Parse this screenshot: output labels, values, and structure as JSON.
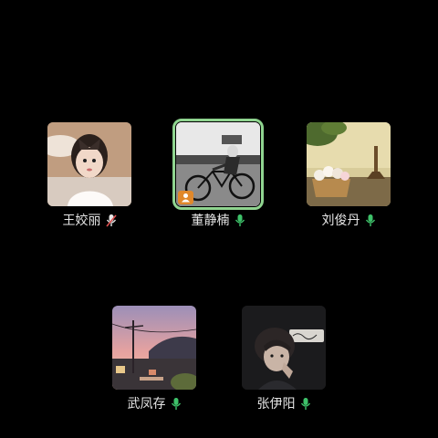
{
  "participants": [
    {
      "name": "王姣丽",
      "mic": "mic-muted-icon",
      "speaking": false,
      "host": false
    },
    {
      "name": "董静楠",
      "mic": "mic-on-icon",
      "speaking": true,
      "host": true
    },
    {
      "name": "刘俊丹",
      "mic": "mic-on-icon",
      "speaking": false,
      "host": false
    },
    {
      "name": "武凤存",
      "mic": "mic-on-icon",
      "speaking": false,
      "host": false
    },
    {
      "name": "张伊阳",
      "mic": "mic-on-icon",
      "speaking": false,
      "host": false
    }
  ],
  "colors": {
    "background": "#000000",
    "speaking_border": "#8fd48f",
    "mic_on": "#3ec26a",
    "mic_muted": "#e6e6e6",
    "host_badge": "#e0882b"
  }
}
